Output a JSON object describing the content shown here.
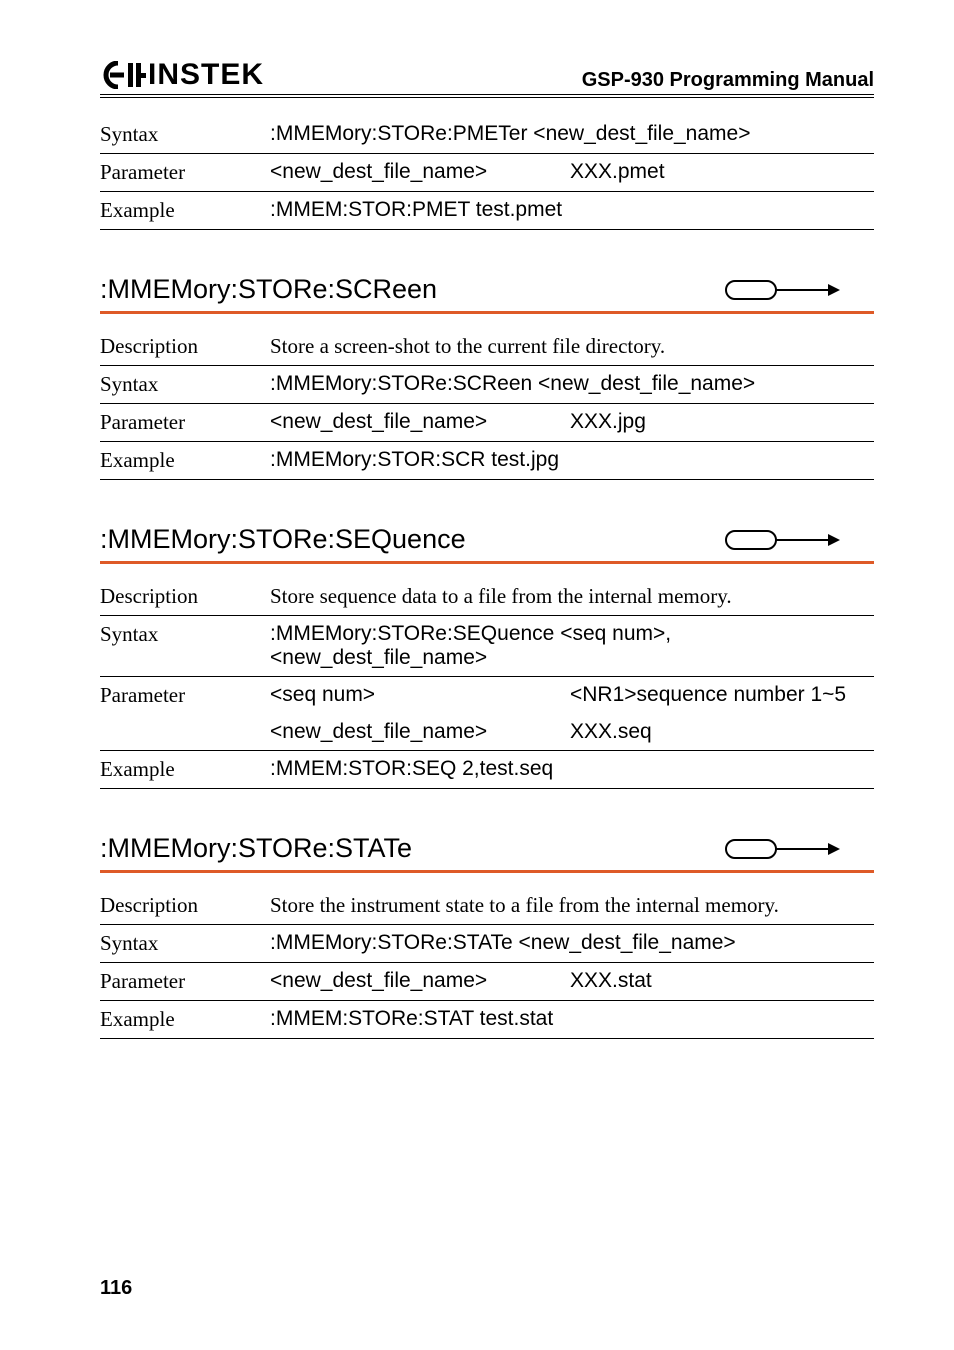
{
  "header": {
    "brand": "INSTEK",
    "manual": "GSP-930 Programming Manual"
  },
  "top": {
    "syntax_k": "Syntax",
    "syntax_v": ":MMEMory:STORe:PMETer <new_dest_file_name>",
    "param_k": "Parameter",
    "param_a": "<new_dest_file_name>",
    "param_b": "XXX.pmet",
    "ex_k": "Example",
    "ex_v": ":MMEM:STOR:PMET test.pmet"
  },
  "screen": {
    "title": ":MMEMory:STORe:SCReen",
    "desc_k": "Description",
    "desc_v": "Store a screen-shot to the current file directory.",
    "syntax_k": "Syntax",
    "syntax_v": ":MMEMory:STORe:SCReen <new_dest_file_name>",
    "param_k": "Parameter",
    "param_a": "<new_dest_file_name>",
    "param_b": "XXX.jpg",
    "ex_k": "Example",
    "ex_v": ":MMEMory:STOR:SCR test.jpg"
  },
  "seq": {
    "title": ":MMEMory:STORe:SEQuence",
    "desc_k": "Description",
    "desc_v": "Store sequence data to a file from the internal memory.",
    "syntax_k": "Syntax",
    "syntax_v": ":MMEMory:STORe:SEQuence <seq num>, <new_dest_file_name>",
    "param_k": "Parameter",
    "param_a1": "<seq num>",
    "param_b1": "<NR1>sequence number 1~5",
    "param_a2": "<new_dest_file_name>",
    "param_b2": "XXX.seq",
    "ex_k": "Example",
    "ex_v": ":MMEM:STOR:SEQ 2,test.seq"
  },
  "state": {
    "title": ":MMEMory:STORe:STATe",
    "desc_k": "Description",
    "desc_v": "Store the instrument state to a file from the internal memory.",
    "syntax_k": "Syntax",
    "syntax_v": ":MMEMory:STORe:STATe <new_dest_file_name>",
    "param_k": "Parameter",
    "param_a": "<new_dest_file_name>",
    "param_b": "XXX.stat",
    "ex_k": "Example",
    "ex_v": ":MMEM:STORe:STAT test.stat"
  },
  "page": "116"
}
